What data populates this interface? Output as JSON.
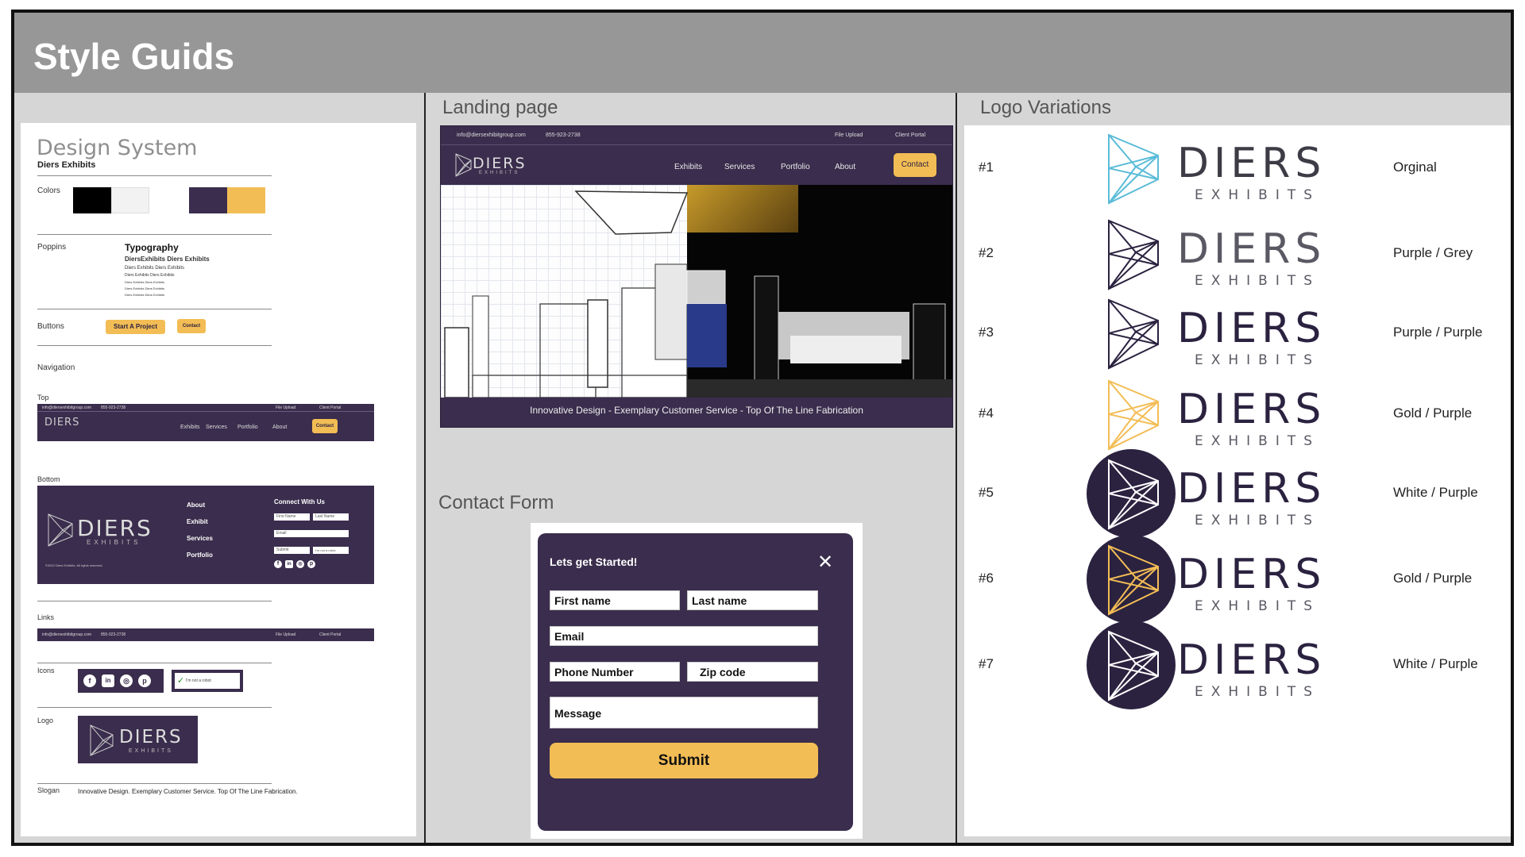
{
  "page_title": "Style Guids",
  "design_system": {
    "title": "Design System",
    "brand": "Diers Exhibits",
    "labels": {
      "colors": "Colors",
      "font": "Poppins",
      "typography": "Typography",
      "buttons": "Buttons",
      "navigation": "Navigation",
      "top": "Top",
      "bottom": "Bottom",
      "links": "Links",
      "icons": "Icons",
      "logo": "Logo",
      "slogan": "Slogan"
    },
    "colors": [
      "#000000",
      "#f2f2f2",
      "#3a2d4d",
      "#f3bd55"
    ],
    "typography_samples": [
      "DiersExhibits Diers Exhibits",
      "Diers Exhibits Diers Exhibits",
      "Diers Exhibits Diers Exhibits",
      "Diers Exhibits Diers Exhibits",
      "Diers Exhibits Diers Exhibits",
      "Diers Exhibits Diers Exhibits"
    ],
    "buttons": {
      "primary": "Start A Project",
      "secondary": "Contact"
    },
    "nav_top": {
      "email": "info@diersexhibitgroup.com",
      "phone": "855-923-2738",
      "file_upload": "File Upload",
      "client_portal": "Client Portal",
      "items": [
        "Exhibits",
        "Services",
        "Portfolio",
        "About"
      ],
      "contact": "Contact"
    },
    "footer": {
      "links": [
        "About",
        "Exhibit",
        "Services",
        "Portfolio"
      ],
      "connect_title": "Connect With Us",
      "first_name": "First Name",
      "last_name": "Last Name",
      "email": "Email",
      "submit": "Submit",
      "captcha": "I'm not a robot",
      "copyright": "©2022 Diers Exhibits. All rights reserved."
    },
    "icons_captcha": "I'm not a robot",
    "logo_word": "DIERS",
    "logo_sub": "EXHIBITS",
    "slogan": "Innovative Design.  Exemplary Customer Service.  Top Of The Line Fabrication."
  },
  "landing_page": {
    "section_title": "Landing page",
    "email": "info@diersexhibitgroup.com",
    "phone": "855-923-2738",
    "file_upload": "File Upload",
    "client_portal": "Client Portal",
    "logo_word": "DIERS",
    "logo_sub": "EXHIBITS",
    "nav": [
      "Exhibits",
      "Services",
      "Portfolio",
      "About"
    ],
    "contact": "Contact",
    "tagline": "Innovative Design -  Exemplary Customer Service  - Top Of The Line Fabrication"
  },
  "contact_form": {
    "section_title": "Contact Form",
    "heading": "Lets get Started!",
    "close": "✕",
    "first_name": "First name",
    "last_name": "Last name",
    "email": "Email",
    "phone": "Phone Number",
    "zip": "Zip code",
    "message": "Message",
    "submit": "Submit"
  },
  "logo_variations": {
    "section_title": "Logo Variations",
    "word": "DIERS",
    "sub": "EXHIBITS",
    "items": [
      {
        "num": "#1",
        "name": "Orginal",
        "mark_color": "#5bbcd8",
        "bg": "none",
        "word_color": "#3d3b45"
      },
      {
        "num": "#2",
        "name": "Purple / Grey",
        "mark_color": "#2b2240",
        "bg": "none",
        "word_color": "#5a5863"
      },
      {
        "num": "#3",
        "name": "Purple / Purple",
        "mark_color": "#2b2240",
        "bg": "none",
        "word_color": "#2b2240"
      },
      {
        "num": "#4",
        "name": "Gold / Purple",
        "mark_color": "#f3bd55",
        "bg": "none",
        "word_color": "#2b2240"
      },
      {
        "num": "#5",
        "name": "White / Purple",
        "mark_color": "#ffffff",
        "bg": "#2b2240",
        "word_color": "#2b2240"
      },
      {
        "num": "#6",
        "name": "Gold / Purple",
        "mark_color": "#f3bd55",
        "bg": "#2b2240",
        "word_color": "#2b2240"
      },
      {
        "num": "#7",
        "name": "White / Purple",
        "mark_color": "#ffffff",
        "bg": "#2b2240",
        "word_color": "#2b2240"
      }
    ]
  }
}
